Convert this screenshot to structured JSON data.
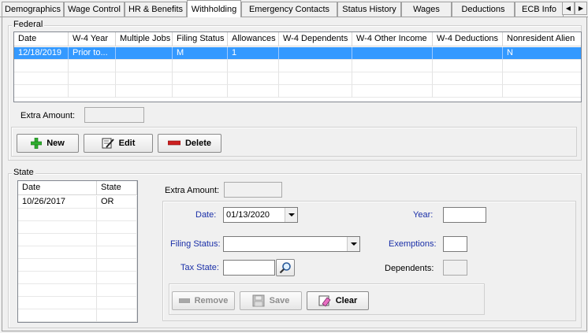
{
  "tabs": [
    {
      "label": "Demographics",
      "active": false
    },
    {
      "label": "Wage Control",
      "active": false
    },
    {
      "label": "HR & Benefits",
      "active": false
    },
    {
      "label": "Withholding",
      "active": true
    },
    {
      "label": "Emergency Contacts",
      "active": false
    },
    {
      "label": "Status History",
      "active": false
    },
    {
      "label": "Wages",
      "active": false
    },
    {
      "label": "Deductions",
      "active": false
    },
    {
      "label": "ECB Info",
      "active": false
    }
  ],
  "tab_scroll": {
    "left": "◀",
    "right": "▶"
  },
  "federal": {
    "title": "Federal",
    "columns": [
      "Date",
      "W-4 Year",
      "Multiple Jobs",
      "Filing Status",
      "Allowances",
      "W-4 Dependents",
      "W-4 Other Income",
      "W-4 Deductions",
      "Nonresident Alien"
    ],
    "rows": [
      [
        "12/18/2019",
        "Prior to...",
        "",
        "M",
        "1",
        "",
        "",
        "",
        "N"
      ]
    ],
    "extra_amount_label": "Extra Amount:",
    "extra_amount_value": "",
    "buttons": {
      "new": "New",
      "edit": "Edit",
      "delete": "Delete"
    }
  },
  "state": {
    "title": "State",
    "columns": [
      "Date",
      "State"
    ],
    "rows": [
      [
        "10/26/2017",
        "OR"
      ]
    ],
    "extra_amount_label": "Extra Amount:",
    "extra_amount_value": "",
    "form": {
      "date_label": "Date:",
      "date_value": "01/13/2020",
      "year_label": "Year:",
      "year_value": "",
      "filing_status_label": "Filing Status:",
      "filing_status_value": "",
      "exemptions_label": "Exemptions:",
      "exemptions_value": "",
      "tax_state_label": "Tax State:",
      "tax_state_value": "",
      "dependents_label": "Dependents:",
      "dependents_value": ""
    },
    "buttons": {
      "remove": "Remove",
      "save": "Save",
      "clear": "Clear"
    }
  },
  "colors": {
    "selection": "#3399ff",
    "label_blue": "#1a2fa8",
    "new_icon": "#2fae2f",
    "delete_icon": "#cc1f1f"
  }
}
